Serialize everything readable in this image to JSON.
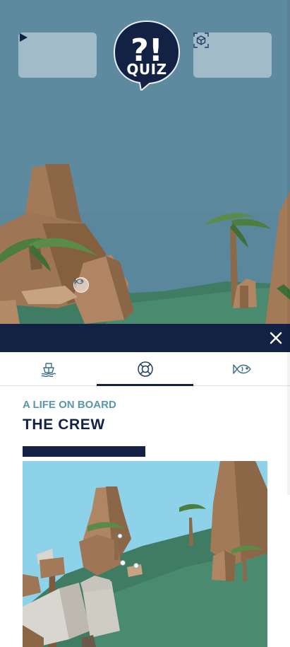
{
  "scene": {
    "play_button": {
      "icon": "play-icon"
    },
    "quiz_badge": {
      "symbol": "?!",
      "label": "QUIZ"
    },
    "ar_button": {
      "icon": "ar-cube-icon"
    },
    "hotspot": {
      "icon": "fish-icon"
    }
  },
  "panel": {
    "close_icon": "close-icon",
    "tabs": [
      {
        "icon": "boat-icon",
        "active": false
      },
      {
        "icon": "lifebuoy-icon",
        "active": true
      },
      {
        "icon": "fish-icon",
        "active": false
      }
    ],
    "kicker": "A LIFE ON BOARD",
    "title": "THE CREW"
  },
  "colors": {
    "navy": "#132244",
    "teal": "#5a96aa",
    "water": "#5e8aa0",
    "grass": "#3f7c63",
    "rock": "#a27a58",
    "sky": "#8ed2ea"
  }
}
